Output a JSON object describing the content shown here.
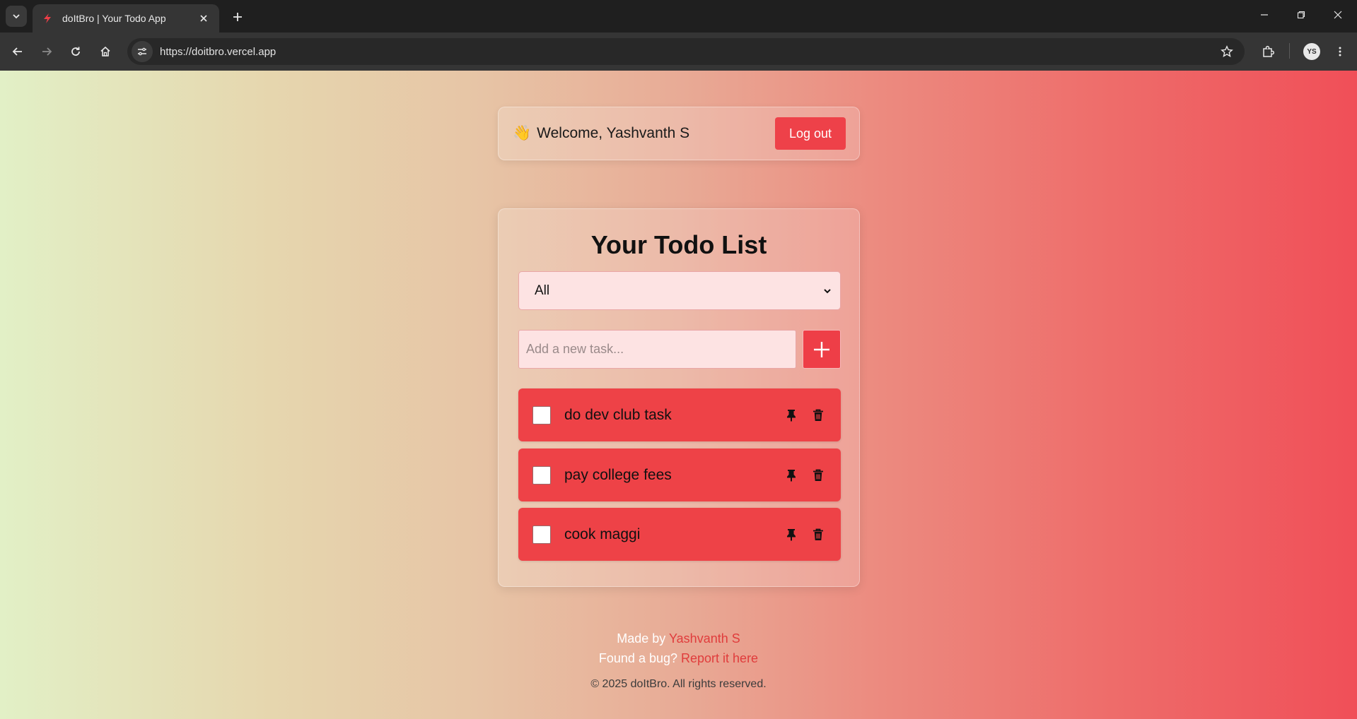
{
  "browser": {
    "tab_title": "doItBro | Your Todo App",
    "url": "https://doitbro.vercel.app"
  },
  "header": {
    "wave_emoji": "👋",
    "welcome_text": "Welcome, Yashvanth S",
    "logout_label": "Log out"
  },
  "todo": {
    "title": "Your Todo List",
    "filter_value": "All",
    "input_placeholder": "Add a new task...",
    "items": [
      {
        "label": "do dev club task",
        "done": false
      },
      {
        "label": "pay college fees",
        "done": false
      },
      {
        "label": "cook maggi",
        "done": false
      }
    ]
  },
  "footer": {
    "made_by_prefix": "Made by",
    "author": "Yashvanth S",
    "bug_prefix": "Found a bug?",
    "bug_link": "Report it here",
    "copyright": "© 2025 doItBro. All rights reserved."
  },
  "colors": {
    "accent": "#ee4149",
    "link": "#e03c3c"
  }
}
